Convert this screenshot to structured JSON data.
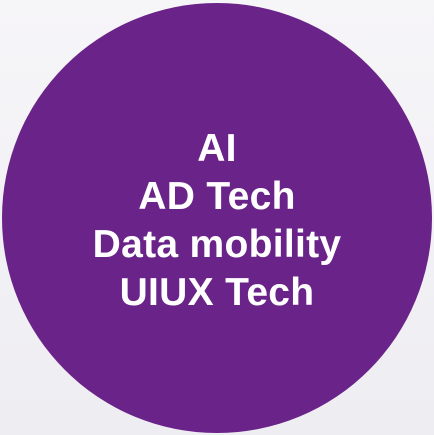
{
  "colors": {
    "background": "#f3f1f6",
    "circle": "#6a2389",
    "text": "#ffffff"
  },
  "circle": {
    "lines": [
      "AI",
      "AD Tech",
      "Data mobility",
      "UIUX Tech"
    ]
  }
}
